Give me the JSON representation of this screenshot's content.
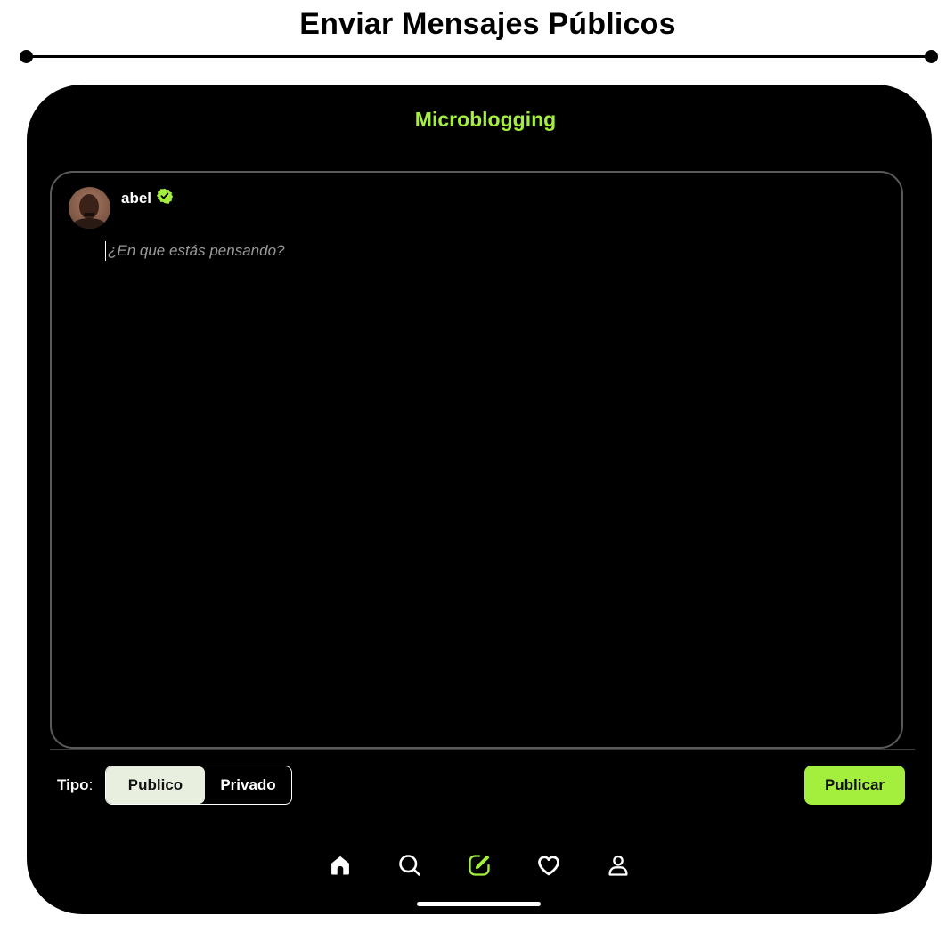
{
  "page": {
    "title": "Enviar Mensajes Públicos"
  },
  "app": {
    "title": "Microblogging",
    "accent_color": "#a4ef3e"
  },
  "composer": {
    "username": "abel",
    "verified_icon": "verified-badge-icon",
    "avatar_icon": "user-photo-avatar",
    "placeholder": "¿En que estás pensando?",
    "value": ""
  },
  "visibility": {
    "label": "Tipo",
    "label_suffix": ":",
    "options": [
      "Publico",
      "Privado"
    ],
    "selected": "Publico"
  },
  "actions": {
    "publish_label": "Publicar"
  },
  "bottom_nav": {
    "items": [
      {
        "name": "home",
        "icon": "home-icon",
        "active": false
      },
      {
        "name": "search",
        "icon": "search-icon",
        "active": false
      },
      {
        "name": "compose",
        "icon": "compose-icon",
        "active": true
      },
      {
        "name": "favorites",
        "icon": "heart-icon",
        "active": false
      },
      {
        "name": "profile",
        "icon": "user-icon",
        "active": false
      }
    ]
  }
}
